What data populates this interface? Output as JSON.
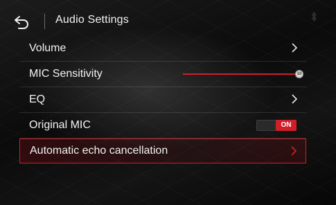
{
  "header": {
    "title": "Audio Settings",
    "back_icon": "back-arrow-icon",
    "status_icon": "bluetooth-icon"
  },
  "menu": {
    "items": [
      {
        "label": "Volume",
        "control": "chevron"
      },
      {
        "label": "MIC Sensitivity",
        "control": "slider",
        "level": 1.0,
        "thumb_text": "10"
      },
      {
        "label": "EQ",
        "control": "chevron"
      },
      {
        "label": "Original MIC",
        "control": "toggle",
        "toggle_text": "ON"
      },
      {
        "label": "Automatic echo cancellation",
        "control": "chevron",
        "selected": true
      }
    ]
  },
  "colors": {
    "accent": "#d11f29",
    "text": "#f3f3f3",
    "background": "#0b0b0b"
  }
}
